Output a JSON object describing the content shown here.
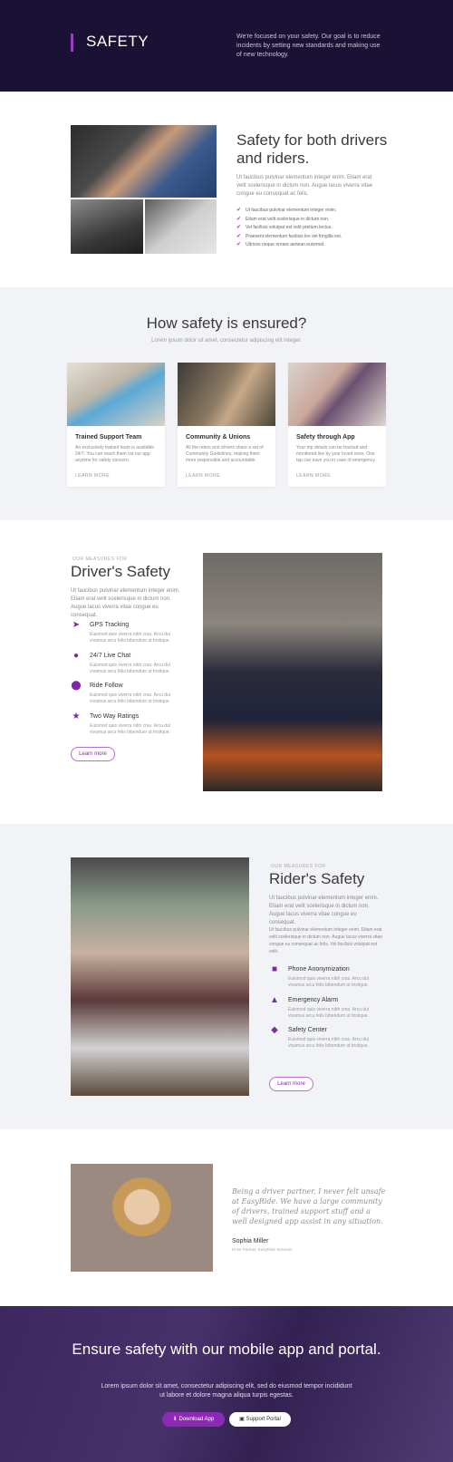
{
  "header": {
    "title": "SAFETY",
    "description": "We're focused on your safety. Our goal is to reduce incidents by setting new standards and making use of new technology."
  },
  "both": {
    "title": "Safety for both drivers and riders.",
    "description": "Ut faucibus pulvinar elementum integer enim. Etiam erat velit scelerisque in dictum non. Augue lacus viverra vitae congue eu consequat ac felis.",
    "items": [
      "Ut faucibus pulvinar elementum integer enim.",
      "Etiam erat velit scelerisque in dictum non.",
      "Vel facilisis volutpat est velit pretium lectus.",
      "Praesent elementum facilisis leo vel fringilla est.",
      "Ultrices neque ornare aenean euismod."
    ]
  },
  "ensured": {
    "title": "How safety is ensured?",
    "subtitle": "Lorem ipsum dolor sit amet, consectetur adipiscing elit integer.",
    "cards": [
      {
        "title": "Trained Support Team",
        "text": "An exclusively trained team is available 24/7. You can reach them via our app anytime for safety concern.",
        "link": "LEARN MORE"
      },
      {
        "title": "Community & Unions",
        "text": "All the riders and drivers share a set of Community Guidelines, making them more responsible and accountable.",
        "link": "LEARN MORE"
      },
      {
        "title": "Safety through App",
        "text": "Your trip details can be tracked and monitored live by your loved ones. One tap can save you in case of emergency.",
        "link": "LEARN MORE"
      }
    ]
  },
  "driver": {
    "eyebrow": "OUR MEASURES FOR",
    "title": "Driver's Safety",
    "description": "Ut faucibus pulvinar elementum integer enim. Etiam erat velit scelerisque in dictum non. Augue lacus viverra vitae congue eu consequat.",
    "features": [
      {
        "title": "GPS Tracking",
        "text": "Euismod quis viverra nibh cras. Arcu dui vivamus arcu felis bibendum ut tristique."
      },
      {
        "title": "24/7 Live Chat",
        "text": "Euismod quis viverra nibh cras. Arcu dui vivamus arcu felis bibendum ut tristique."
      },
      {
        "title": "Ride Follow",
        "text": "Euismod quis viverra nibh cras. Arcu dui vivamus arcu felis bibendum ut tristique."
      },
      {
        "title": "Two Way Ratings",
        "text": "Euismod quis viverra nibh cras. Arcu dui vivamus arcu felis bibendum ut tristique."
      }
    ],
    "button": "Learn more"
  },
  "rider": {
    "eyebrow": "OUR MEASURES FOR",
    "title": "Rider's Safety",
    "description1": "Ut faucibus pulvinar elementum integer enim. Etiam erat velit scelerisque in dictum non. Augue lacus viverra vitae congue eu consequat.",
    "description2": "Ut faucibus pulvinar elementum integer enim. Etiam erat velit scelerisque in dictum non. Augue lacus viverra vitae congue eu consequat ac felis. Vel facilisis volutpat est velit.",
    "features": [
      {
        "title": "Phone Anonymization",
        "text": "Euismod quis viverra nibh cras. Arcu dui vivamus arcu felis bibendum ut tristique."
      },
      {
        "title": "Emergency Alarm",
        "text": "Euismod quis viverra nibh cras. Arcu dui vivamus arcu felis bibendum ut tristique."
      },
      {
        "title": "Safety Center",
        "text": "Euismod quis viverra nibh cras. Arcu dui vivamus arcu felis bibendum ut tristique."
      }
    ],
    "button": "Learn more"
  },
  "testimonial": {
    "quote": "Being a driver partner, I never felt unsafe at EasyRide. We have a large community of drivers, trained support stuff and a well designed app assist in any situation.",
    "name": "Sophia Miller",
    "role": "Drive Partner, EasyRide Services"
  },
  "cta": {
    "title": "Ensure safety with our mobile app and portal.",
    "description": "Lorem ipsum dolor sit amet, consectetur adipiscing elit, sed do eiusmod tempor incididunt ut labore et dolore magna aliqua turpis egestas.",
    "primary": "Download App",
    "secondary": "Support Portal"
  },
  "colors": {
    "header_bg": "#1a1135",
    "accent": "#9b3dbf",
    "section_gray": "#f2f3f6"
  }
}
